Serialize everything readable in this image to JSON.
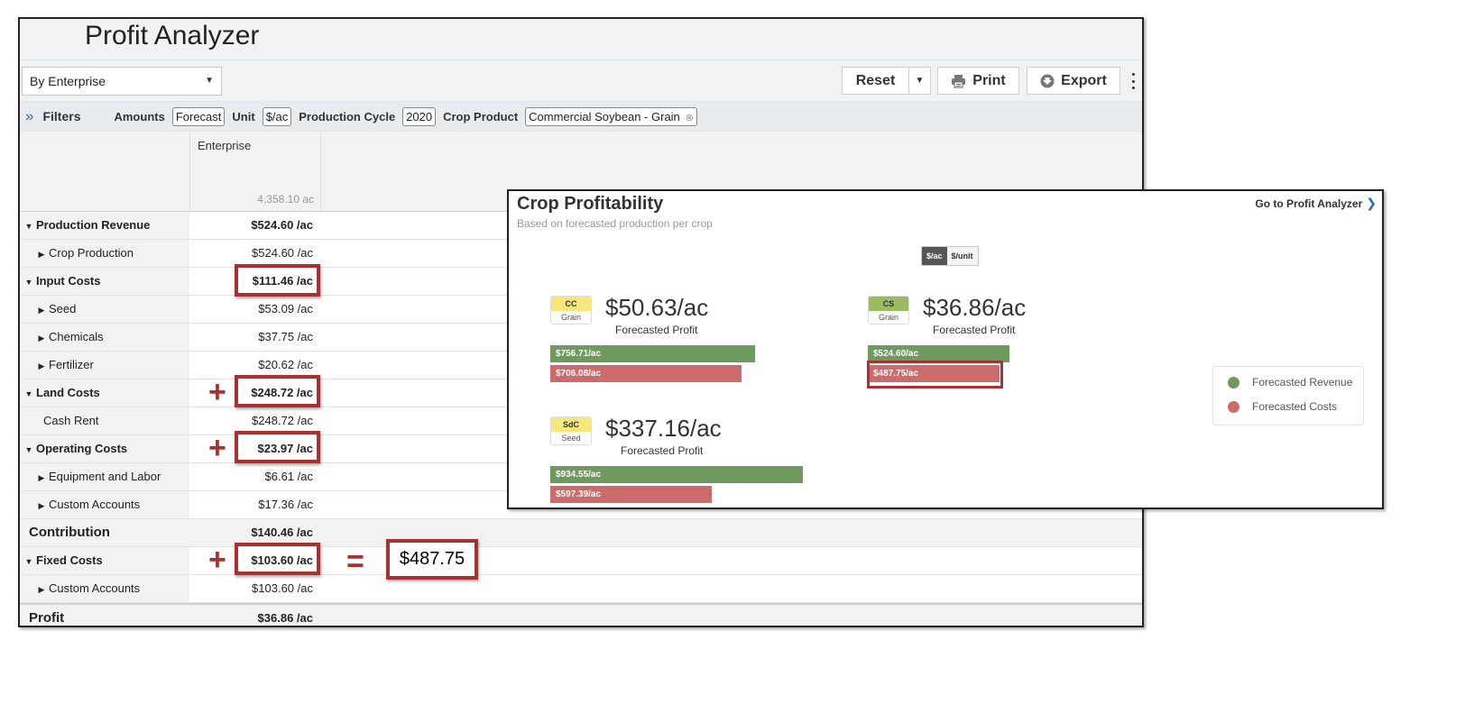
{
  "app": {
    "title": "Profit Analyzer"
  },
  "toolbar": {
    "view_select": "By Enterprise",
    "reset_label": "Reset",
    "print_label": "Print",
    "export_label": "Export"
  },
  "filters": {
    "title": "Filters",
    "amounts_label": "Amounts",
    "amounts_value": "Forecast",
    "unit_label": "Unit",
    "unit_value": "$/ac",
    "cycle_label": "Production Cycle",
    "cycle_value": "2020",
    "crop_label": "Crop Product",
    "crop_value": "Commercial Soybean - Grain"
  },
  "table": {
    "column_header": "Enterprise",
    "column_acres": "4,358.10 ac",
    "rows": [
      {
        "label": "Production Revenue",
        "value": "$524.60 /ac"
      },
      {
        "label": "Crop Production",
        "value": "$524.60 /ac"
      },
      {
        "label": "Input Costs",
        "value": "$111.46 /ac"
      },
      {
        "label": "Seed",
        "value": "$53.09 /ac"
      },
      {
        "label": "Chemicals",
        "value": "$37.75 /ac"
      },
      {
        "label": "Fertilizer",
        "value": "$20.62 /ac"
      },
      {
        "label": "Land Costs",
        "value": "$248.72 /ac"
      },
      {
        "label": "Cash Rent",
        "value": "$248.72 /ac"
      },
      {
        "label": "Operating Costs",
        "value": "$23.97 /ac"
      },
      {
        "label": "Equipment and Labor",
        "value": "$6.61 /ac"
      },
      {
        "label": "Custom Accounts",
        "value": "$17.36 /ac"
      },
      {
        "label": "Contribution",
        "value": "$140.46 /ac"
      },
      {
        "label": "Fixed Costs",
        "value": "$103.60 /ac"
      },
      {
        "label": "Custom Accounts",
        "value": "$103.60 /ac"
      },
      {
        "label": "Profit",
        "value": "$36.86 /ac"
      }
    ]
  },
  "annotation": {
    "plus": "+",
    "equals": "=",
    "total": "$487.75"
  },
  "crop_profitability": {
    "title": "Crop Profitability",
    "subtitle": "Based on forecasted production per crop",
    "goto_link": "Go to Profit Analyzer",
    "unit_toggle": {
      "active": "$/ac",
      "inactive": "$/unit"
    },
    "profit_caption": "Forecasted Profit",
    "colors": {
      "revenue": "#6f9a5e",
      "cost": "#cc6b6b",
      "highlight": "#a83232"
    },
    "crops": [
      {
        "code": "CC",
        "type": "Grain",
        "badge_color": "#f7e77a",
        "profit": "$50.63/ac",
        "revenue": 756.71,
        "revenue_label": "$756.71/ac",
        "cost": 706.08,
        "cost_label": "$706.08/ac"
      },
      {
        "code": "CS",
        "type": "Grain",
        "badge_color": "#9bbb62",
        "profit": "$36.86/ac",
        "revenue": 524.6,
        "revenue_label": "$524.60/ac",
        "cost": 487.75,
        "cost_label": "$487.75/ac"
      },
      {
        "code": "SdC",
        "type": "Seed",
        "badge_color": "#f7e77a",
        "profit": "$337.16/ac",
        "revenue": 934.55,
        "revenue_label": "$934.55/ac",
        "cost": 597.39,
        "cost_label": "$597.39/ac"
      }
    ],
    "legend": {
      "revenue": "Forecasted Revenue",
      "cost": "Forecasted Costs"
    }
  }
}
